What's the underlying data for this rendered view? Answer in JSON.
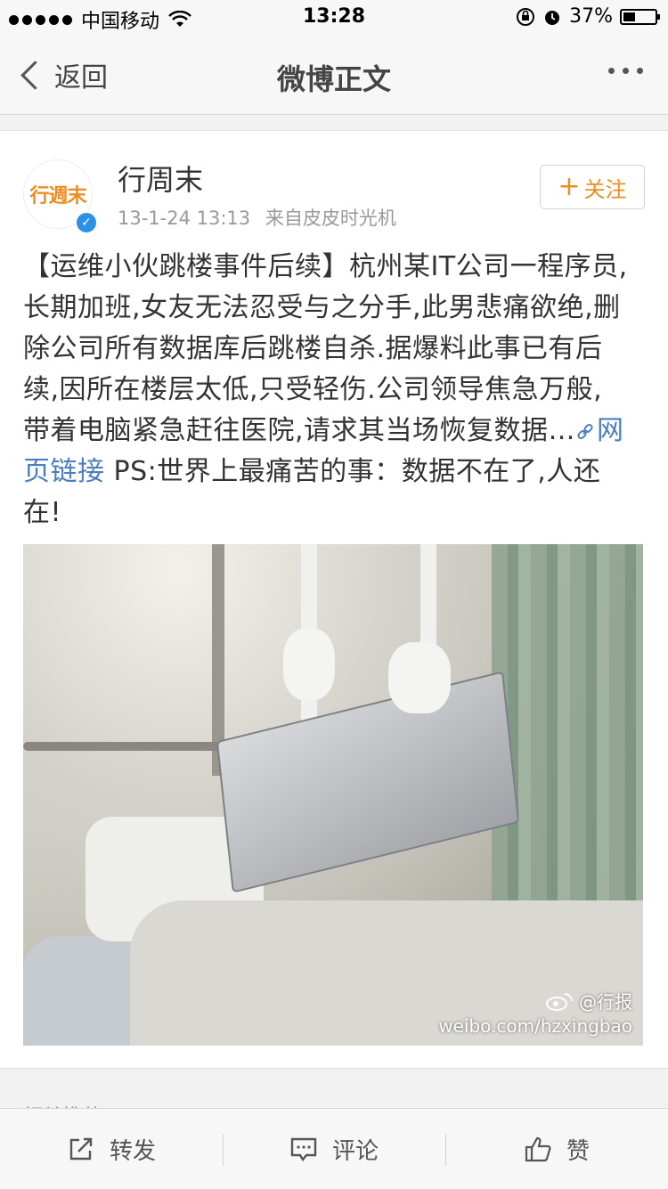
{
  "status_bar": {
    "carrier": "中国移动",
    "time": "13:28",
    "battery": "37%",
    "battery_level": 0.37
  },
  "navbar": {
    "back_label": "返回",
    "title": "微博正文"
  },
  "post": {
    "username": "行周末",
    "avatar_text": "行週末",
    "timestamp": "13-1-24 13:13",
    "source": "来自皮皮时光机",
    "follow_label": "关注",
    "text_before_link": "【运维小伙跳楼事件后续】杭州某IT公司一程序员,长期加班,女友无法忍受与之分手,此男悲痛欲绝,删除公司所有数据库后跳楼自杀.据爆料此事已有后续,因所在楼层太低,只受轻伤.公司领导焦急万般,带着电脑紧急赶往医院,请求其当场恢复数据…",
    "link_text": "网页链接",
    "text_after_link": " PS:世界上最痛苦的事：数据不在了,人还在!",
    "image_watermark_handle": "@行报",
    "image_watermark_url": "weibo.com/hzxingbao"
  },
  "related_label": "相关推荐",
  "toolbar": {
    "repost_label": "转发",
    "comment_label": "评论",
    "like_label": "赞"
  },
  "colors": {
    "accent_orange": "#f08c1e",
    "link_blue": "#4a7ec2",
    "verified_blue": "#2b90e8"
  }
}
